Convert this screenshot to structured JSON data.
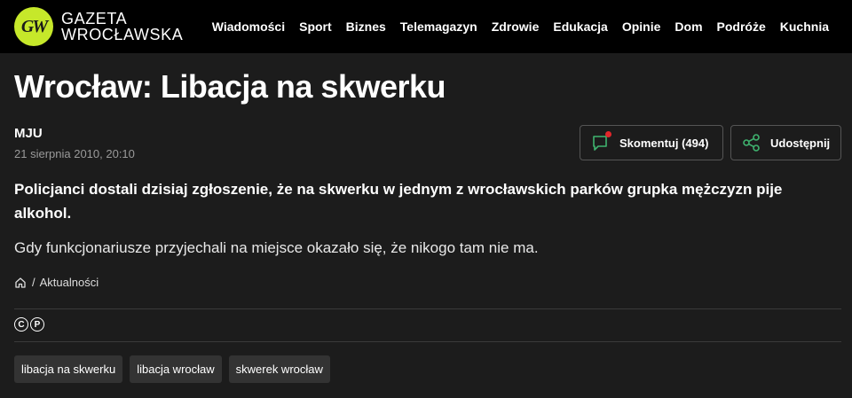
{
  "brand": {
    "badge": "GW",
    "line1": "GAZETA",
    "line2": "WROCŁAWSKA",
    "accent": "#c6e82a"
  },
  "nav": [
    "Wiadomości",
    "Sport",
    "Biznes",
    "Telemagazyn",
    "Zdrowie",
    "Edukacja",
    "Opinie",
    "Dom",
    "Podróże",
    "Kuchnia"
  ],
  "article": {
    "title": "Wrocław: Libacja na skwerku",
    "author": "MJU",
    "date": "21 sierpnia 2010, 20:10",
    "lead": "Policjanci dostali dzisiaj zgłoszenie, że na skwerku w jednym z wrocławskich parków grupka mężczyzn pije alkohol.",
    "body": "Gdy funkcjonariusze przyjechali na miejsce okazało się, że nikogo tam nie ma."
  },
  "actions": {
    "comment_label": "Skomentuj (494)",
    "share_label": "Udostępnij",
    "notification_color": "#e3262b"
  },
  "breadcrumb": {
    "separator": "/",
    "section": "Aktualności"
  },
  "rights": {
    "copyright": "C",
    "phonogram": "P"
  },
  "tags": [
    "libacja na skwerku",
    "libacja wrocław",
    "skwerek wrocław"
  ]
}
